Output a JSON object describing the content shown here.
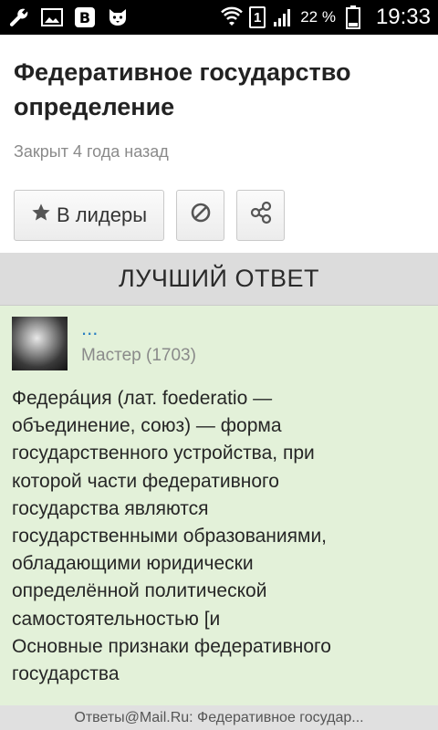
{
  "status_bar": {
    "icons": [
      "wrench-icon",
      "image-icon",
      "vk-icon",
      "cat-icon",
      "wifi-icon",
      "sim-1-icon",
      "signal-icon",
      "battery-icon"
    ],
    "sim_label": "1",
    "battery_percent": "22 %",
    "time": "19:33"
  },
  "question": {
    "title": "Федеративное государство определение",
    "closed": "Закрыт 4 года назад"
  },
  "actions": {
    "leader_label": "В лидеры",
    "icons": [
      "star-icon",
      "block-icon",
      "share-icon"
    ]
  },
  "best_answer": {
    "heading": "ЛУЧШИЙ ОТВЕТ",
    "author_name": "...",
    "author_rank": "Мастер (1703)",
    "text": "Федерáция (лат. foederatio —\nобъединение, союз) — форма\nгосударственного устройства, при\nкоторой части федеративного\nгосударства являются\nгосударственными образованиями,\nобладающими юридически\nопределённой политической\nсамостоятельностью [и\nОсновные признаки федеративного\nгосударства"
  },
  "footer": {
    "text": "Ответы@Mail.Ru: Федеративное государ..."
  }
}
